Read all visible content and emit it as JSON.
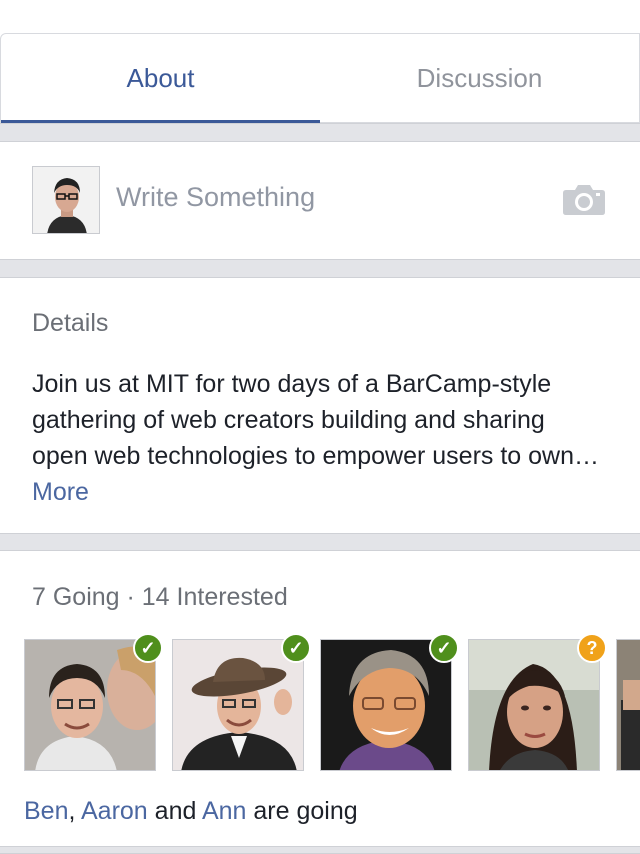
{
  "tabs": {
    "about": "About",
    "discussion": "Discussion"
  },
  "composer": {
    "placeholder": "Write Something",
    "avatar": "profile-photo",
    "camera_icon": "camera-icon"
  },
  "details": {
    "title": "Details",
    "text": "Join us at MIT for two days of a BarCamp-style gathering of web creators building and sharing open web technologies to empower users to own…",
    "more": "More"
  },
  "guests": {
    "going_count": "7 Going",
    "separator": " · ",
    "interested_count": "14 Interested",
    "people": [
      {
        "status": "going",
        "badge": "✓"
      },
      {
        "status": "going",
        "badge": "✓"
      },
      {
        "status": "going",
        "badge": "✓"
      },
      {
        "status": "maybe",
        "badge": "?"
      }
    ],
    "summary": {
      "name1": "Ben",
      "sep1": ", ",
      "name2": "Aaron",
      "and": " and ",
      "name3": "Ann",
      "suffix": " are going"
    }
  },
  "colors": {
    "accent": "#3b5998",
    "link": "#4b67a1",
    "going": "#4f8f1c",
    "maybe": "#f0a21a"
  }
}
